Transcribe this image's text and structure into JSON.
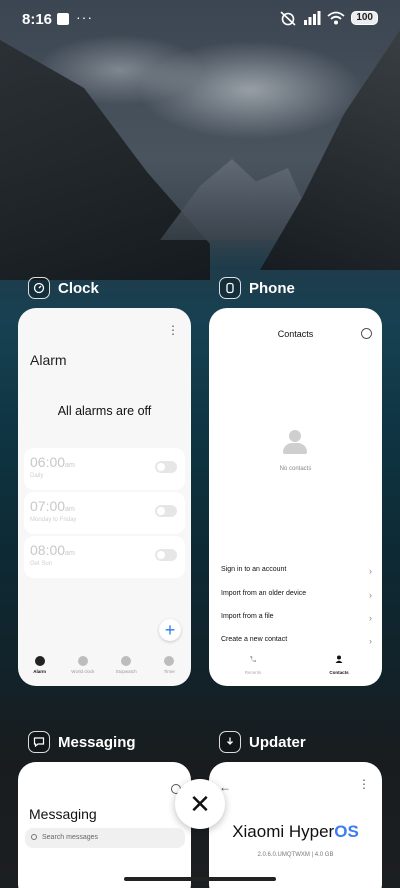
{
  "status_bar": {
    "time": "8:16",
    "more": "···",
    "battery": "100"
  },
  "apps": {
    "clock": {
      "name": "Clock",
      "title": "Alarm",
      "more": "⋮",
      "empty_message": "All alarms are off",
      "alarms": [
        {
          "time": "06:00",
          "ampm": "am",
          "label": "Daily",
          "enabled": false
        },
        {
          "time": "07:00",
          "ampm": "am",
          "label": "Monday to Friday",
          "enabled": false
        },
        {
          "time": "08:00",
          "ampm": "am",
          "label": "Get Sun",
          "enabled": false
        }
      ],
      "fab": "+",
      "tabs": [
        "Alarm",
        "World clock",
        "Stopwatch",
        "Timer"
      ]
    },
    "phone": {
      "name": "Phone",
      "title": "Contacts",
      "empty_message": "No contacts",
      "actions": [
        "Sign in to an account",
        "Import from an older device",
        "Import from a file",
        "Create a new contact"
      ],
      "tabs": [
        "Recents",
        "Contacts"
      ]
    },
    "messaging": {
      "name": "Messaging",
      "title": "Messaging",
      "search_placeholder": "Search messages"
    },
    "updater": {
      "name": "Updater",
      "back": "←",
      "more": "⋮",
      "brand_prefix": "Xiaomi Hyper",
      "brand_suffix": "OS",
      "version": "2.0.6.0.UMQTWXM | 4.0 GB",
      "accent_color": "#3d7bf5"
    }
  },
  "close_button": "✕"
}
